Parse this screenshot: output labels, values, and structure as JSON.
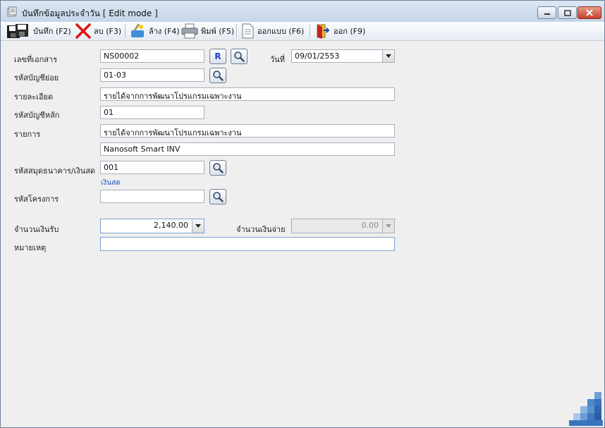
{
  "window": {
    "title": "บันทึกข้อมูลประจำวัน [ Edit mode ]"
  },
  "toolbar": {
    "save_label": "บันทึก (F2)",
    "delete_label": "ลบ (F3)",
    "clear_label": "ล้าง (F4)",
    "print_label": "พิมพ์ (F5)",
    "design_label": "ออกแบบ (F6)",
    "exit_label": "ออก (F9)"
  },
  "form": {
    "doc_no_label": "เลขที่เอกสาร",
    "doc_no_value": "NS00002",
    "r_button": "R",
    "date_label": "วันที่",
    "date_value": "09/01/2553",
    "sub_account_label": "รหัสบัญชีย่อย",
    "sub_account_value": "01-03",
    "detail_label": "รายละเอียด",
    "detail_value": "รายได้จากการพัฒนาโปรแกรมเฉพาะงาน",
    "main_account_label": "รหัสบัญชีหลัก",
    "main_account_value": "01",
    "item_label": "รายการ",
    "item_value": "รายได้จากการพัฒนาโปรแกรมเฉพาะงาน",
    "item_value2": "Nanosoft Smart INV",
    "bank_code_label": "รหัสสมุดธนาคาร/เงินสด",
    "bank_code_value": "001",
    "bank_code_name": "เงินสด",
    "project_label": "รหัสโครงการ",
    "project_value": "",
    "income_label": "จำนวนเงินรับ",
    "income_value": "2,140.00",
    "expense_label": "จำนวนเงินจ่าย",
    "expense_value": "0.00",
    "note_label": "หมายเหตุ",
    "note_value": ""
  }
}
